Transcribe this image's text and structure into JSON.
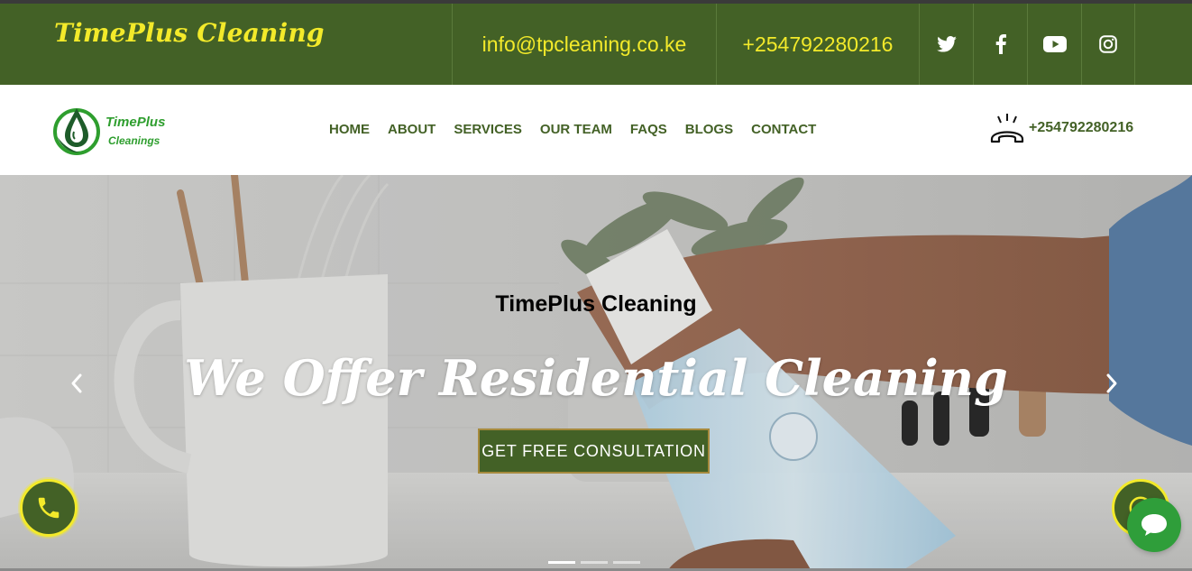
{
  "topbar": {
    "brand": "TimePlus Cleaning",
    "email": "info@tpcleaning.co.ke",
    "phone": "+254792280216",
    "social": [
      "twitter-icon",
      "facebook-icon",
      "youtube-icon",
      "instagram-icon"
    ]
  },
  "logo": {
    "line1": "TimePlus",
    "line2": "Cleanings"
  },
  "nav": {
    "items": [
      "HOME",
      "ABOUT",
      "SERVICES",
      "OUR TEAM",
      "FAQS",
      "BLOGS",
      "CONTACT"
    ],
    "phone": "+254792280216"
  },
  "hero": {
    "subtitle": "TimePlus Cleaning",
    "title": "We Offer Residential Cleaning",
    "cta": "GET FREE CONSULTATION",
    "slides": 3,
    "active_slide": 1
  },
  "colors": {
    "brand_green": "#436126",
    "accent_yellow": "#f3ea2a",
    "chat_green": "#2f9e3a"
  }
}
